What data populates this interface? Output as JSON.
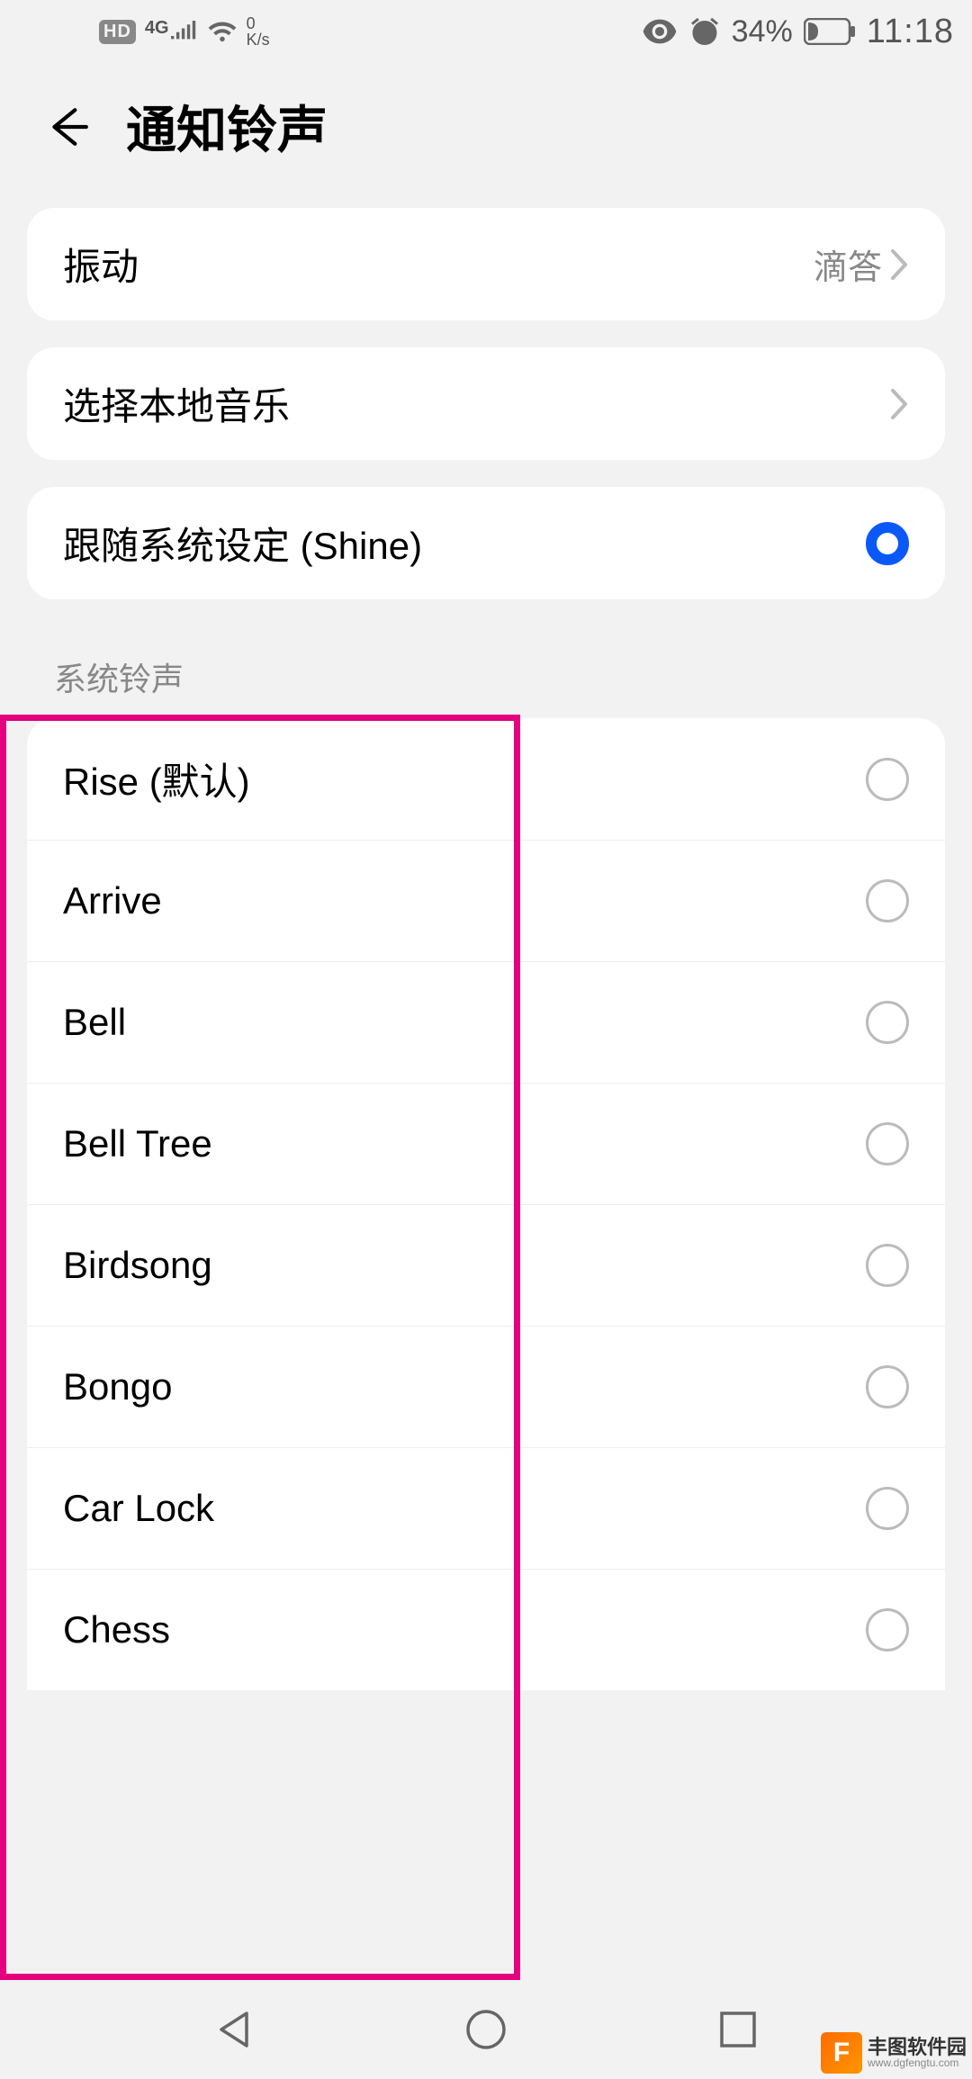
{
  "status": {
    "hd": "HD",
    "network_type": "4G",
    "speed_value": "0",
    "speed_unit": "K/s",
    "battery_pct": "34%",
    "time": "11:18"
  },
  "header": {
    "title": "通知铃声"
  },
  "vibration": {
    "label": "振动",
    "value": "滴答"
  },
  "local_music": {
    "label": "选择本地音乐"
  },
  "follow_system": {
    "label": "跟随系统设定 (Shine)"
  },
  "section": {
    "title": "系统铃声"
  },
  "ringtones": [
    {
      "label": "Rise (默认)"
    },
    {
      "label": "Arrive"
    },
    {
      "label": "Bell"
    },
    {
      "label": "Bell Tree"
    },
    {
      "label": "Birdsong"
    },
    {
      "label": "Bongo"
    },
    {
      "label": "Car Lock"
    },
    {
      "label": "Chess"
    }
  ],
  "watermark": {
    "name": "丰图软件园",
    "url": "www.dgfengtu.com"
  }
}
